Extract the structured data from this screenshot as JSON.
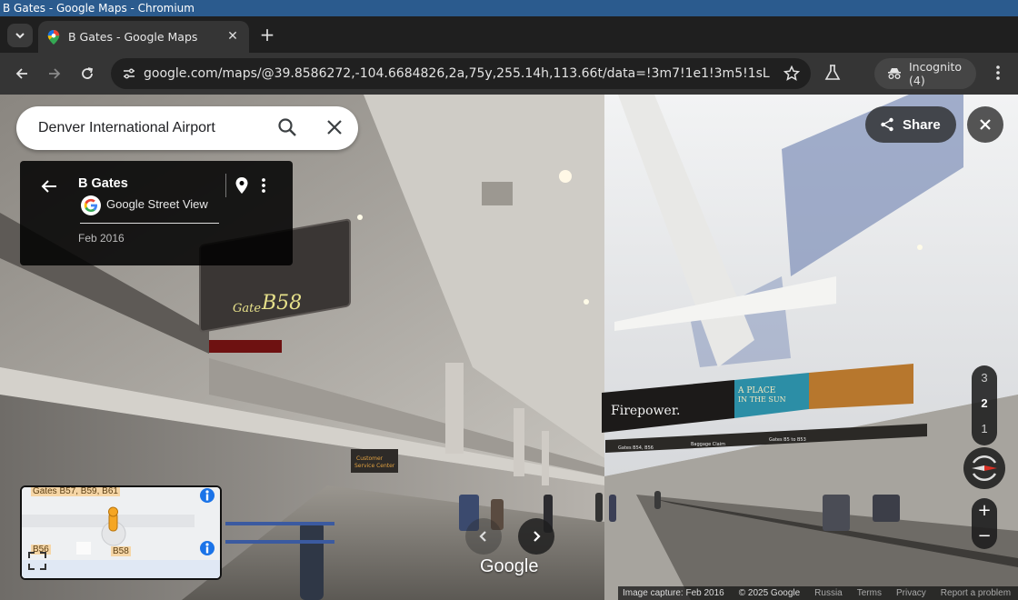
{
  "window": {
    "title": "B Gates - Google Maps - Chromium"
  },
  "tabs": [
    {
      "label": "B Gates - Google Maps",
      "close": "✕"
    }
  ],
  "toolbar": {
    "url": "google.com/maps/@39.8586272,-104.6684826,2a,75y,255.14h,113.66t/data=!3m7!1e1!3m5!1sL1NsLmxkBFAi...",
    "incognito_label": "Incognito (4)"
  },
  "search": {
    "query": "Denver International Airport"
  },
  "info_card": {
    "title": "B Gates",
    "source": "Google Street View",
    "date": "Feb 2016"
  },
  "share": {
    "label": "Share"
  },
  "floor_selector": {
    "floors": [
      "3",
      "2",
      "1"
    ],
    "current": "2"
  },
  "zoom": {
    "in": "+",
    "out": "−"
  },
  "minimap": {
    "labels": {
      "gates_top": "Gates B57, B59, B61",
      "b56": "B56",
      "b58": "B58"
    }
  },
  "scene": {
    "gate_sign": {
      "gate": "Gate",
      "number": "B58"
    },
    "customer_service": [
      "Customer",
      "Service Center"
    ],
    "ads": {
      "firepower": "Firepower.",
      "place_in_sun_1": "A PLACE",
      "place_in_sun_2": "IN THE SUN"
    },
    "direction_sign": {
      "left": "Gates B54, B56",
      "middle": "Baggage Claim",
      "right": "Gates B5 to B53"
    }
  },
  "branding": {
    "logo_text": "Google"
  },
  "footer": {
    "capture": "Image capture: Feb 2016",
    "copyright": "© 2025 Google",
    "country": "Russia",
    "terms": "Terms",
    "privacy": "Privacy",
    "report": "Report a problem"
  },
  "colors": {
    "titlebar": "#2b5b8e",
    "toolbar": "#353535",
    "card_bg": "#000000"
  }
}
